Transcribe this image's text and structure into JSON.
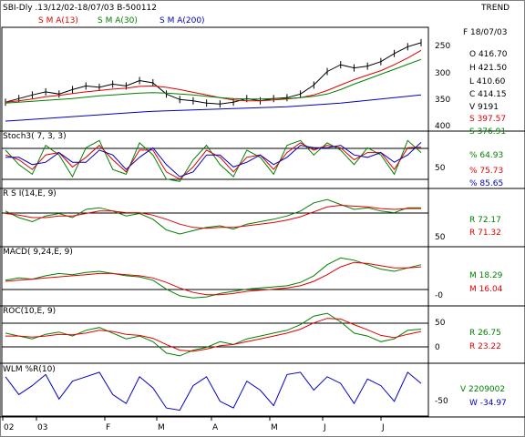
{
  "header": {
    "title": "SBI-Dly .13/12/02-18/07/03  B-500112",
    "trend": "TREND",
    "sma13": "S M A(13)",
    "sma30": "S M A(30)",
    "sma200": "S M A(200)"
  },
  "ohlc": {
    "date": "F 18/07/03",
    "o": "O    416.70",
    "h": "H    421.50",
    "l": "L    410.60",
    "c": "C    414.15",
    "v": "V      9191",
    "s1": "S    397.57",
    "s2": "S    376.91"
  },
  "panels": {
    "stoch": {
      "title": "Stoch3( 7, 3, 3)",
      "v1": "%     64.93",
      "v2": "%     75.73",
      "v3": "%     85.65"
    },
    "rsi": {
      "title": "R S I(14,E, 9)",
      "v1": "R    72.17",
      "v2": "R    71.32"
    },
    "macd": {
      "title": "MACD( 9,24,E, 9)",
      "v1": "M    18.29",
      "v2": "M    16.04"
    },
    "roc": {
      "title": "ROC(10,E, 9)",
      "v1": "R    26.75",
      "v2": "R    23.22"
    },
    "wlm": {
      "title": "WLM %R(10)",
      "v1": "V 2209002",
      "v2": "W    -34.97"
    }
  },
  "colors": {
    "price": "#000000",
    "sma13": "#e00000",
    "sma30": "#008000",
    "sma200": "#0000c0",
    "frame": "#000000",
    "background": "#ffffff"
  },
  "chart_data": [
    {
      "type": "line",
      "title": "SBI-Dly .13/12/02-18/07/03  B-500112",
      "ylabel": "",
      "y_ticks": [
        "250",
        "300",
        "350",
        "400"
      ],
      "ylim": [
        230,
        440
      ],
      "x_labels": [
        "02",
        "03",
        "F",
        "M",
        "A",
        "M",
        "J",
        "J"
      ],
      "x": [
        0,
        1,
        2,
        3,
        4,
        5,
        6,
        7,
        8,
        9,
        10,
        11,
        12,
        13,
        14,
        15,
        16,
        17,
        18,
        19,
        20,
        21,
        22,
        23,
        24,
        25,
        26,
        27,
        28,
        29,
        30,
        31
      ],
      "series": [
        {
          "name": "price",
          "values": [
            282,
            290,
            298,
            305,
            300,
            310,
            318,
            315,
            322,
            318,
            330,
            325,
            300,
            288,
            285,
            280,
            278,
            282,
            290,
            285,
            290,
            292,
            300,
            320,
            350,
            365,
            358,
            362,
            372,
            390,
            405,
            414
          ]
        },
        {
          "name": "S M A(13)",
          "values": [
            282,
            285,
            289,
            294,
            297,
            301,
            305,
            308,
            311,
            313,
            317,
            318,
            315,
            310,
            304,
            298,
            292,
            287,
            285,
            285,
            287,
            289,
            292,
            298,
            308,
            320,
            332,
            342,
            352,
            365,
            380,
            397
          ]
        },
        {
          "name": "S M A(30)",
          "values": [
            280,
            282,
            284,
            286,
            288,
            290,
            293,
            296,
            298,
            300,
            302,
            303,
            302,
            300,
            298,
            295,
            292,
            290,
            289,
            289,
            290,
            290,
            292,
            295,
            300,
            310,
            322,
            333,
            344,
            355,
            366,
            377
          ]
        },
        {
          "name": "S M A(200)",
          "values": [
            240,
            242,
            244,
            246,
            248,
            250,
            252,
            254,
            256,
            258,
            260,
            262,
            263,
            264,
            265,
            266,
            267,
            268,
            269,
            270,
            271,
            272,
            274,
            276,
            278,
            280,
            283,
            286,
            289,
            292,
            295,
            298
          ]
        }
      ]
    },
    {
      "type": "line",
      "title": "Stoch3( 7, 3, 3)",
      "y_ticks": [
        "50"
      ],
      "ylim": [
        0,
        100
      ],
      "x": [
        0,
        1,
        2,
        3,
        4,
        5,
        6,
        7,
        8,
        9,
        10,
        11,
        12,
        13,
        14,
        15,
        16,
        17,
        18,
        19,
        20,
        21,
        22,
        23,
        24,
        25,
        26,
        27,
        28,
        29,
        30,
        31
      ],
      "series": [
        {
          "name": "%K",
          "values": [
            70,
            40,
            20,
            80,
            60,
            15,
            75,
            90,
            30,
            20,
            85,
            60,
            10,
            5,
            50,
            80,
            40,
            15,
            70,
            55,
            20,
            80,
            90,
            60,
            85,
            70,
            40,
            75,
            60,
            20,
            90,
            65
          ]
        },
        {
          "name": "%D",
          "values": [
            60,
            50,
            30,
            60,
            65,
            35,
            55,
            80,
            50,
            25,
            70,
            70,
            25,
            10,
            35,
            70,
            55,
            25,
            55,
            60,
            30,
            65,
            85,
            70,
            80,
            75,
            50,
            65,
            65,
            30,
            75,
            76
          ]
        },
        {
          "name": "%S",
          "values": [
            55,
            55,
            40,
            45,
            65,
            45,
            45,
            70,
            60,
            30,
            55,
            75,
            40,
            15,
            25,
            60,
            60,
            35,
            45,
            60,
            40,
            55,
            80,
            75,
            75,
            80,
            60,
            55,
            65,
            45,
            60,
            86
          ]
        }
      ]
    },
    {
      "type": "line",
      "title": "R S I(14,E, 9)",
      "y_ticks": [
        "50"
      ],
      "ylim": [
        30,
        90
      ],
      "x": [
        0,
        1,
        2,
        3,
        4,
        5,
        6,
        7,
        8,
        9,
        10,
        11,
        12,
        13,
        14,
        15,
        16,
        17,
        18,
        19,
        20,
        21,
        22,
        23,
        24,
        25,
        26,
        27,
        28,
        29,
        30,
        31
      ],
      "series": [
        {
          "name": "RSI",
          "values": [
            68,
            60,
            55,
            62,
            65,
            60,
            70,
            72,
            68,
            62,
            65,
            58,
            45,
            40,
            44,
            48,
            50,
            46,
            52,
            55,
            58,
            62,
            68,
            78,
            82,
            76,
            70,
            72,
            68,
            66,
            72,
            72
          ]
        },
        {
          "name": "Signal",
          "values": [
            65,
            63,
            60,
            60,
            62,
            62,
            65,
            68,
            68,
            66,
            66,
            63,
            58,
            52,
            48,
            47,
            48,
            48,
            50,
            52,
            54,
            57,
            61,
            67,
            73,
            75,
            74,
            73,
            71,
            70,
            71,
            71
          ]
        }
      ]
    },
    {
      "type": "line",
      "title": "MACD( 9,24,E, 9)",
      "y_ticks": [
        "-0"
      ],
      "ylim": [
        -15,
        30
      ],
      "x": [
        0,
        1,
        2,
        3,
        4,
        5,
        6,
        7,
        8,
        9,
        10,
        11,
        12,
        13,
        14,
        15,
        16,
        17,
        18,
        19,
        20,
        21,
        22,
        23,
        24,
        25,
        26,
        27,
        28,
        29,
        30,
        31
      ],
      "series": [
        {
          "name": "MACD",
          "values": [
            4,
            6,
            5,
            8,
            10,
            9,
            11,
            12,
            10,
            8,
            7,
            4,
            -4,
            -10,
            -12,
            -11,
            -8,
            -6,
            -4,
            -3,
            -2,
            -1,
            2,
            8,
            18,
            24,
            22,
            18,
            14,
            12,
            15,
            18
          ]
        },
        {
          "name": "Signal",
          "values": [
            3,
            4,
            5,
            6,
            7,
            8,
            9,
            10,
            10,
            9,
            8,
            6,
            2,
            -3,
            -7,
            -9,
            -9,
            -8,
            -6,
            -5,
            -4,
            -3,
            -1,
            3,
            9,
            16,
            20,
            19,
            17,
            15,
            15,
            16
          ]
        }
      ]
    },
    {
      "type": "line",
      "title": "ROC(10,E, 9)",
      "y_ticks": [
        "50",
        "0"
      ],
      "ylim": [
        -25,
        60
      ],
      "x": [
        0,
        1,
        2,
        3,
        4,
        5,
        6,
        7,
        8,
        9,
        10,
        11,
        12,
        13,
        14,
        15,
        16,
        17,
        18,
        19,
        20,
        21,
        22,
        23,
        24,
        25,
        26,
        27,
        28,
        29,
        30,
        31
      ],
      "series": [
        {
          "name": "ROC",
          "values": [
            20,
            15,
            10,
            18,
            22,
            15,
            25,
            30,
            20,
            10,
            15,
            5,
            -15,
            -20,
            -10,
            -5,
            5,
            0,
            10,
            15,
            20,
            25,
            35,
            50,
            55,
            40,
            20,
            15,
            5,
            10,
            25,
            27
          ]
        },
        {
          "name": "Signal",
          "values": [
            15,
            15,
            13,
            15,
            18,
            17,
            20,
            25,
            23,
            18,
            16,
            11,
            0,
            -10,
            -12,
            -8,
            -2,
            0,
            5,
            10,
            15,
            20,
            27,
            38,
            46,
            45,
            35,
            26,
            16,
            12,
            18,
            23
          ]
        }
      ]
    },
    {
      "type": "line",
      "title": "WLM %R(10)",
      "y_ticks": [
        "-50"
      ],
      "ylim": [
        -100,
        0
      ],
      "x": [
        0,
        1,
        2,
        3,
        4,
        5,
        6,
        7,
        8,
        9,
        10,
        11,
        12,
        13,
        14,
        15,
        16,
        17,
        18,
        19,
        20,
        21,
        22,
        23,
        24,
        25,
        26,
        27,
        28,
        29,
        30,
        31
      ],
      "series": [
        {
          "name": "%R",
          "values": [
            -20,
            -60,
            -40,
            -15,
            -70,
            -30,
            -20,
            -10,
            -60,
            -80,
            -20,
            -45,
            -90,
            -95,
            -40,
            -20,
            -75,
            -90,
            -30,
            -50,
            -85,
            -15,
            -10,
            -50,
            -20,
            -35,
            -80,
            -25,
            -40,
            -75,
            -10,
            -35
          ]
        }
      ]
    }
  ]
}
